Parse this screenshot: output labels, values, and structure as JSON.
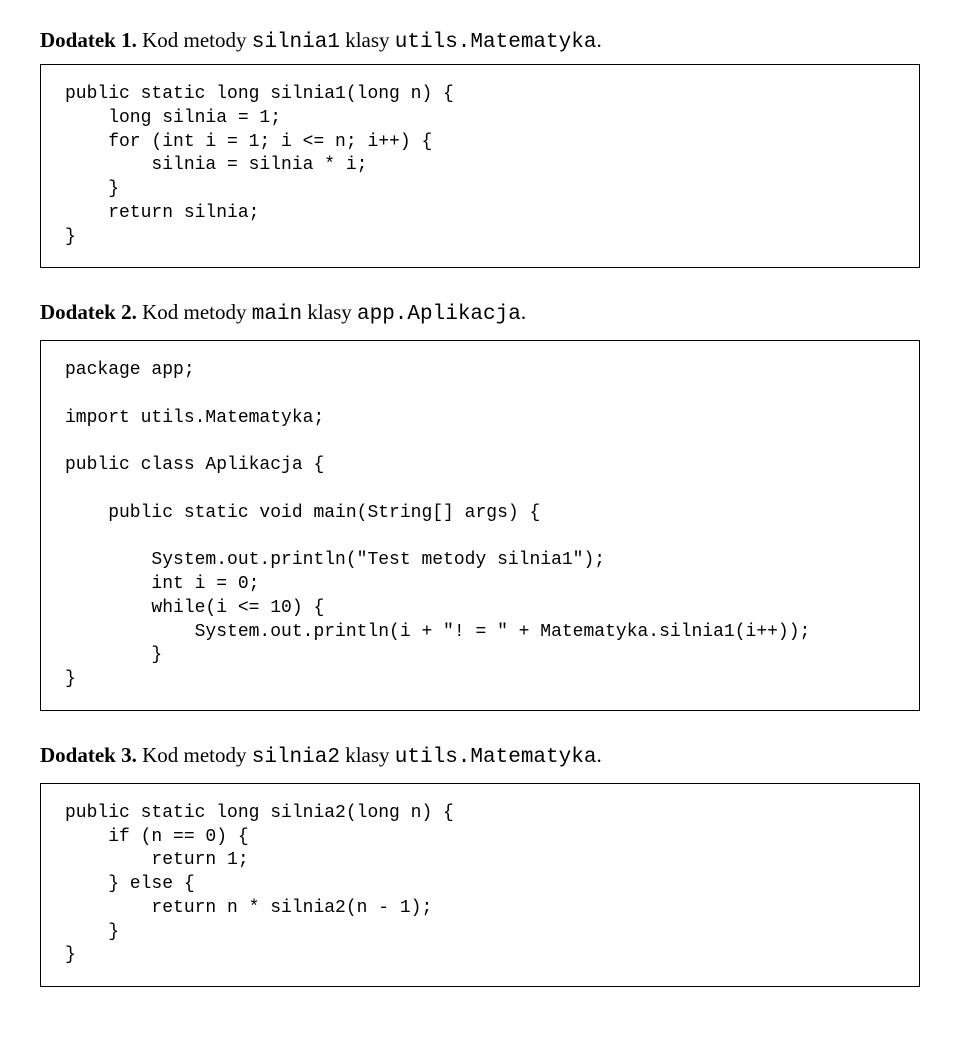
{
  "sections": [
    {
      "heading_bold": "Dodatek 1.",
      "heading_plain": " Kod metody ",
      "heading_mono1": "silnia1",
      "heading_mid": " klasy ",
      "heading_mono2": "utils.Matematyka",
      "heading_end": ".",
      "code": "public static long silnia1(long n) {\n    long silnia = 1;\n    for (int i = 1; i <= n; i++) {\n        silnia = silnia * i;\n    }\n    return silnia;\n}"
    },
    {
      "heading_bold": "Dodatek 2.",
      "heading_plain": " Kod metody ",
      "heading_mono1": "main",
      "heading_mid": " klasy ",
      "heading_mono2": "app.Aplikacja",
      "heading_end": ".",
      "code": "package app;\n\nimport utils.Matematyka;\n\npublic class Aplikacja {\n\n    public static void main(String[] args) {\n\n        System.out.println(\"Test metody silnia1\");\n        int i = 0;\n        while(i <= 10) {\n            System.out.println(i + \"! = \" + Matematyka.silnia1(i++));\n        }\n}"
    },
    {
      "heading_bold": "Dodatek 3.",
      "heading_plain": " Kod metody ",
      "heading_mono1": "silnia2",
      "heading_mid": " klasy ",
      "heading_mono2": "utils.Matematyka",
      "heading_end": ".",
      "code": "public static long silnia2(long n) {\n    if (n == 0) {\n        return 1;\n    } else {\n        return n * silnia2(n - 1);\n    }\n}"
    }
  ]
}
